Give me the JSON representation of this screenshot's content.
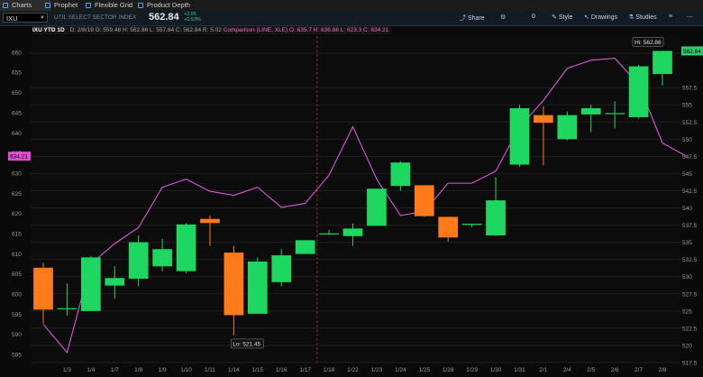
{
  "tabs": [
    {
      "label": "Charts",
      "active": true
    },
    {
      "label": "Prophet",
      "active": false
    },
    {
      "label": "Flexible Grid",
      "active": false
    },
    {
      "label": "Product Depth",
      "active": false
    }
  ],
  "toolbar": {
    "symbol": "IXU",
    "description": "UTIL SELECT SECTOR INDEX",
    "last": "562.84",
    "change_lines": [
      "+2.95",
      "+0.53%"
    ],
    "buttons": [
      {
        "label": "Share",
        "icon": "share-icon"
      },
      {
        "label": "Style",
        "icon": "style-icon"
      },
      {
        "label": "Drawings",
        "icon": "drawings-icon"
      },
      {
        "label": "Studies",
        "icon": "studies-icon"
      }
    ],
    "number": "0"
  },
  "ohlc": {
    "title": "IXU YTD 1D",
    "values": "D: 2/8/19   O: 559.48   H: 562.86   L: 557.84   C: 562.84   R: 5.02",
    "comparison": "Comparison (LINE, XLE)   O: 635.7   H: 636.86   L: 623.3   C: 634.21"
  },
  "chart_data": {
    "type": "candlestick",
    "x_labels": [
      "1/3",
      "1/4",
      "1/7",
      "1/8",
      "1/9",
      "1/10",
      "1/11",
      "1/14",
      "1/15",
      "1/16",
      "1/17",
      "1/18",
      "1/22",
      "1/23",
      "1/24",
      "1/25",
      "1/28",
      "1/29",
      "1/30",
      "1/31",
      "2/1",
      "2/4",
      "2/5",
      "2/6",
      "2/7",
      "2/8"
    ],
    "candles": [
      {
        "o": 531.3,
        "h": 532.0,
        "l": 523.2,
        "c": 525.2
      },
      {
        "o": 525.4,
        "h": 529.0,
        "l": 524.3,
        "c": 525.4
      },
      {
        "o": 525.0,
        "h": 533.0,
        "l": 525.0,
        "c": 532.8
      },
      {
        "o": 528.7,
        "h": 531.5,
        "l": 526.8,
        "c": 529.8
      },
      {
        "o": 529.7,
        "h": 536.0,
        "l": 528.6,
        "c": 535.0
      },
      {
        "o": 531.5,
        "h": 535.5,
        "l": 530.8,
        "c": 534.0
      },
      {
        "o": 530.8,
        "h": 537.8,
        "l": 530.5,
        "c": 537.6
      },
      {
        "o": 538.4,
        "h": 538.9,
        "l": 534.5,
        "c": 537.8
      },
      {
        "o": 533.5,
        "h": 534.5,
        "l": 521.45,
        "c": 524.4
      },
      {
        "o": 524.6,
        "h": 532.8,
        "l": 524.6,
        "c": 532.2
      },
      {
        "o": 529.2,
        "h": 534.0,
        "l": 528.6,
        "c": 533.1
      },
      {
        "o": 533.3,
        "h": 535.3,
        "l": 533.3,
        "c": 535.3
      },
      {
        "o": 536.3,
        "h": 536.8,
        "l": 536.1,
        "c": 536.3
      },
      {
        "o": 535.9,
        "h": 537.7,
        "l": 534.5,
        "c": 537.0
      },
      {
        "o": 537.4,
        "h": 542.8,
        "l": 537.4,
        "c": 542.8
      },
      {
        "o": 543.2,
        "h": 546.8,
        "l": 542.5,
        "c": 546.6
      },
      {
        "o": 543.3,
        "h": 543.3,
        "l": 538.7,
        "c": 538.8
      },
      {
        "o": 538.7,
        "h": 538.7,
        "l": 535.1,
        "c": 535.7
      },
      {
        "o": 537.7,
        "h": 537.7,
        "l": 537.2,
        "c": 537.7
      },
      {
        "o": 536.0,
        "h": 544.5,
        "l": 535.9,
        "c": 541.1
      },
      {
        "o": 546.3,
        "h": 555.0,
        "l": 546.0,
        "c": 554.5
      },
      {
        "o": 553.5,
        "h": 554.8,
        "l": 546.2,
        "c": 552.4
      },
      {
        "o": 550.0,
        "h": 554.0,
        "l": 549.8,
        "c": 553.5
      },
      {
        "o": 553.6,
        "h": 555.0,
        "l": 551.0,
        "c": 554.5
      },
      {
        "o": 553.8,
        "h": 555.5,
        "l": 551.6,
        "c": 553.8
      },
      {
        "o": 553.2,
        "h": 560.8,
        "l": 553.0,
        "c": 560.6
      },
      {
        "o": 559.48,
        "h": 562.86,
        "l": 557.84,
        "c": 562.84
      }
    ],
    "comparison_line": {
      "name": "XLE",
      "values": [
        592.5,
        585.5,
        607.5,
        612.5,
        616.5,
        626.5,
        628.5,
        625.5,
        624.5,
        626.5,
        621.5,
        622.5,
        629.5,
        641.5,
        628.5,
        619.5,
        620.5,
        627.5,
        627.5,
        630.5,
        641.5,
        648.0,
        656.0,
        658.0,
        658.5,
        652.0,
        637.5,
        634.21
      ]
    },
    "right_axis": {
      "ylim": [
        517.5,
        565.0
      ],
      "ticks": [
        "562.5",
        "557.5",
        "555",
        "552.5",
        "550",
        "547.5",
        "545",
        "542.5",
        "540",
        "537.5",
        "535",
        "532.5",
        "530",
        "527.5",
        "525",
        "522.5",
        "520",
        "517.5"
      ]
    },
    "left_axis": {
      "ylim": [
        583.0,
        664.0
      ],
      "ticks": [
        "660",
        "655",
        "650",
        "645",
        "640",
        "635",
        "630",
        "625",
        "620",
        "615",
        "610",
        "605",
        "600",
        "595",
        "590",
        "585"
      ]
    },
    "last_price_badge": "562.84",
    "comparison_badge": "634.21",
    "hi_label": "Hi: 562.86",
    "lo_label": "Lo: 521.45",
    "colors": {
      "up": "#1ed760",
      "down": "#ff7a1a",
      "line": "#d858d8",
      "grid": "#1f1f1f",
      "divider": "#8a2b2b"
    }
  }
}
